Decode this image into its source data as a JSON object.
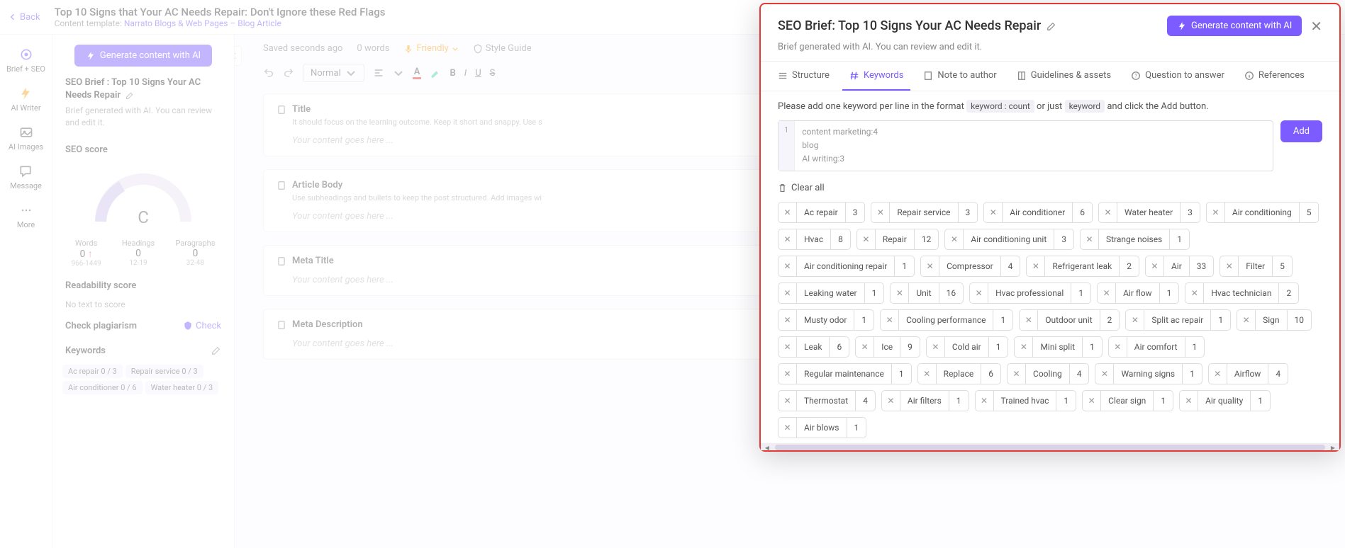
{
  "header": {
    "back": "Back",
    "title": "Top 10 Signs that Your AC Needs Repair: Don't Ignore these Red Flags",
    "template_label": "Content template:",
    "template_link": "Narrato Blogs & Web Pages – Blog Article"
  },
  "left_nav": {
    "brief": "Brief + SEO",
    "writer": "AI Writer",
    "images": "AI Images",
    "message": "Message",
    "more": "More"
  },
  "side": {
    "generate": "Generate content with AI",
    "brief_title": "SEO Brief : Top 10 Signs Your AC Needs Repair",
    "brief_sub": "Brief generated with AI. You can review and edit it.",
    "seo_score_label": "SEO score",
    "gauge_letter": "C",
    "stats": {
      "words_label": "Words",
      "words_val": "0",
      "words_range": "966-1449",
      "headings_label": "Headings",
      "headings_val": "0",
      "headings_range": "12-19",
      "paragraphs_label": "Paragraphs",
      "paragraphs_val": "0",
      "paragraphs_range": "32-48"
    },
    "readability_label": "Readability score",
    "readability_text": "No text to score",
    "plagiarism_label": "Check plagiarism",
    "plagiarism_check": "Check",
    "keywords_label": "Keywords",
    "keywords": [
      {
        "t": "Ac repair",
        "c": "0 / 3"
      },
      {
        "t": "Repair service",
        "c": "0 / 3"
      },
      {
        "t": "Air conditioner",
        "c": "0 / 6"
      },
      {
        "t": "Water heater",
        "c": "0 / 3"
      }
    ]
  },
  "editor": {
    "saved": "Saved seconds ago",
    "words": "0 words",
    "tone": "Friendly",
    "style_guide": "Style Guide",
    "format_normal": "Normal",
    "blocks": {
      "title": {
        "h": "Title",
        "hint": "It should focus on the learning outcome. Keep it short and snappy. Use s",
        "ph": "Your content goes here ..."
      },
      "body": {
        "h": "Article Body",
        "hint": "Use subheadings and bullets to keep the post structured. Add images wi",
        "ph": "Your content goes here ..."
      },
      "meta_title": {
        "h": "Meta Title",
        "ph": "Your content goes here ..."
      },
      "meta_desc": {
        "h": "Meta Description",
        "ph": "Your content goes here ..."
      }
    }
  },
  "modal": {
    "title": "SEO Brief: Top 10 Signs Your AC Needs Repair",
    "generate": "Generate content with AI",
    "sub": "Brief generated with AI. You can review and edit it.",
    "tabs": {
      "structure": "Structure",
      "keywords": "Keywords",
      "note": "Note to author",
      "guidelines": "Guidelines & assets",
      "question": "Question to answer",
      "references": "References"
    },
    "instruction_pre": "Please add one keyword per line in the format",
    "instruction_code1": "keyword : count",
    "instruction_mid": "or just",
    "instruction_code2": "keyword",
    "instruction_post": "and click the Add button.",
    "textarea_lines": [
      "content marketing:4",
      "blog",
      "AI writing:3"
    ],
    "add": "Add",
    "clear_all": "Clear all",
    "tags": [
      {
        "n": "Ac repair",
        "c": "3"
      },
      {
        "n": "Repair service",
        "c": "3"
      },
      {
        "n": "Air conditioner",
        "c": "6"
      },
      {
        "n": "Water heater",
        "c": "3"
      },
      {
        "n": "Air conditioning",
        "c": "5"
      },
      {
        "n": "Hvac",
        "c": "8"
      },
      {
        "n": "Repair",
        "c": "12"
      },
      {
        "n": "Air conditioning unit",
        "c": "3"
      },
      {
        "n": "Strange noises",
        "c": "1"
      },
      {
        "n": "Air conditioning repair",
        "c": "1"
      },
      {
        "n": "Compressor",
        "c": "4"
      },
      {
        "n": "Refrigerant leak",
        "c": "2"
      },
      {
        "n": "Air",
        "c": "33"
      },
      {
        "n": "Filter",
        "c": "5"
      },
      {
        "n": "Leaking water",
        "c": "1"
      },
      {
        "n": "Unit",
        "c": "16"
      },
      {
        "n": "Hvac professional",
        "c": "1"
      },
      {
        "n": "Air flow",
        "c": "1"
      },
      {
        "n": "Hvac technician",
        "c": "2"
      },
      {
        "n": "Musty odor",
        "c": "1"
      },
      {
        "n": "Cooling performance",
        "c": "1"
      },
      {
        "n": "Outdoor unit",
        "c": "2"
      },
      {
        "n": "Split ac repair",
        "c": "1"
      },
      {
        "n": "Sign",
        "c": "10"
      },
      {
        "n": "Leak",
        "c": "6"
      },
      {
        "n": "Ice",
        "c": "9"
      },
      {
        "n": "Cold air",
        "c": "1"
      },
      {
        "n": "Mini split",
        "c": "1"
      },
      {
        "n": "Air comfort",
        "c": "1"
      },
      {
        "n": "Regular maintenance",
        "c": "1"
      },
      {
        "n": "Replace",
        "c": "6"
      },
      {
        "n": "Cooling",
        "c": "4"
      },
      {
        "n": "Warning signs",
        "c": "1"
      },
      {
        "n": "Airflow",
        "c": "4"
      },
      {
        "n": "Thermostat",
        "c": "4"
      },
      {
        "n": "Air filters",
        "c": "1"
      },
      {
        "n": "Trained hvac",
        "c": "1"
      },
      {
        "n": "Clear sign",
        "c": "1"
      },
      {
        "n": "Air quality",
        "c": "1"
      },
      {
        "n": "Air blows",
        "c": "1"
      }
    ]
  }
}
